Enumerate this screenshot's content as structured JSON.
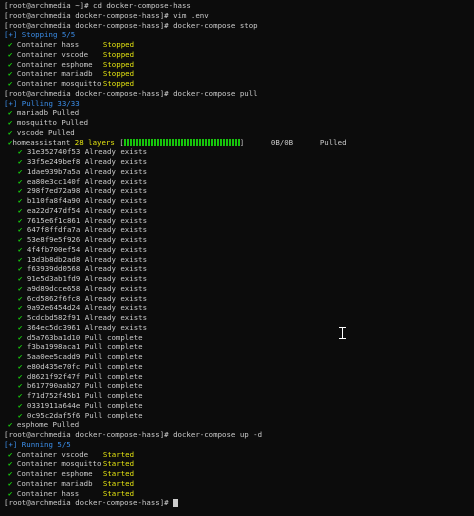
{
  "prompts": [
    {
      "text": "[root@archmedia ~]# cd docker-compose-hass"
    },
    {
      "text": "[root@archmedia docker-compose-hass]# vim .env"
    },
    {
      "text": "[root@archmedia docker-compose-hass]# docker-compose stop"
    },
    {
      "text": "[root@archmedia docker-compose-hass]# docker-compose pull"
    },
    {
      "text": "[root@archmedia docker-compose-hass]# docker-compose up -d"
    },
    {
      "text": "[root@archmedia docker-compose-hass]# "
    }
  ],
  "stop": {
    "header": "[+] Stopping 5/5",
    "items": [
      {
        "name": "Container hass",
        "status": "Stopped"
      },
      {
        "name": "Container vscode",
        "status": "Stopped"
      },
      {
        "name": "Container esphome",
        "status": "Stopped"
      },
      {
        "name": "Container mariadb",
        "status": "Stopped"
      },
      {
        "name": "Container mosquitto",
        "status": "Stopped"
      }
    ]
  },
  "pull": {
    "header": "[+] Pulling 33/33",
    "services_before": [
      "mariadb Pulled",
      "mosquitto Pulled",
      "vscode Pulled"
    ],
    "homeassistant": {
      "name": "homeassistant",
      "layers": "28 layers",
      "bracket_open": "[",
      "bracket_close": "]",
      "size": "0B/0B",
      "status": "Pulled"
    },
    "layers": [
      "31e352740f53 Already exists",
      "33f5e249bef8 Already exists",
      "1dae939b7a5a Already exists",
      "ea80e3cc140f Already exists",
      "298f7ed72a98 Already exists",
      "b110fa8f4a90 Already exists",
      "ea22d747df54 Already exists",
      "7615e6f1c861 Already exists",
      "647f8ffdfa7a Already exists",
      "53e8f9e5f926 Already exists",
      "4f4fb700ef54 Already exists",
      "13d3b8db2ad8 Already exists",
      "f63939dd0568 Already exists",
      "91e5d3ab1fd9 Already exists",
      "a9d89dcce658 Already exists",
      "6cd5862f6fc8 Already exists",
      "9a92e6454d24 Already exists",
      "5cdcbd582f91 Already exists",
      "364ec5dc3961 Already exists",
      "d5a763ba1d10 Pull complete",
      "f3ba1998aca1 Pull complete",
      "5aa0ee5cadd9 Pull complete",
      "e80d435e70fc Pull complete",
      "d8621f92f47f Pull complete",
      "b617790aab27 Pull complete",
      "f71d752f45b1 Pull complete",
      "0331911a644e Pull complete",
      "0c95c2daf5f6 Pull complete"
    ],
    "services_after": [
      "esphome Pulled"
    ]
  },
  "up": {
    "header": "[+] Running 5/5",
    "items": [
      {
        "name": "Container vscode",
        "status": "Started"
      },
      {
        "name": "Container mosquitto",
        "status": "Started"
      },
      {
        "name": "Container esphome",
        "status": "Started"
      },
      {
        "name": "Container mariadb",
        "status": "Started"
      },
      {
        "name": "Container hass",
        "status": "Started"
      }
    ]
  },
  "check_glyph": "✔",
  "colors": {
    "background": "#0c0c0c",
    "text": "#cccccc",
    "header_blue": "#3b8eea",
    "check_green": "#16c60c",
    "status_yellow": "#e5e510"
  }
}
